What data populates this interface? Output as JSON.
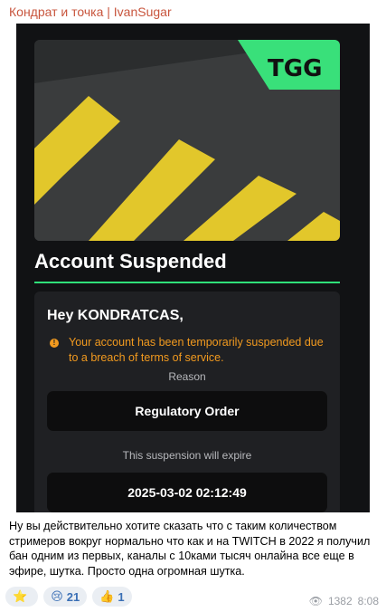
{
  "channel": {
    "title": "Кондрат и точка | IvanSugar"
  },
  "banner": {
    "logo_text": "TGG"
  },
  "email": {
    "title": "Account Suspended",
    "greeting": "Hey KONDRATCAS,",
    "warning_icon": "!",
    "warning": "Your account has been temporarily suspended due to a breach of terms of service.",
    "reason_label": "Reason",
    "reason_value": "Regulatory Order",
    "expire_label": "This suspension will expire",
    "expire_value": "2025-03-02 02:12:49"
  },
  "message": {
    "text": "Ну вы действительно хотите сказать что с таким количеством стримеров вокруг нормально что как и на TWITCH в 2022 я получил бан одним из первых, каналы с 10ками тысяч онлайна все еще в эфире, шутка. Просто одна огромная шутка."
  },
  "reactions": [
    {
      "emoji": "⭐",
      "count": ""
    },
    {
      "emoji": "😢",
      "count": "21"
    },
    {
      "emoji": "👍",
      "count": "1"
    }
  ],
  "meta": {
    "views": "1382",
    "time": "8:08"
  },
  "colors": {
    "accent": "#2fe079",
    "warning": "#f29a1f",
    "channel": "#c8553d"
  }
}
